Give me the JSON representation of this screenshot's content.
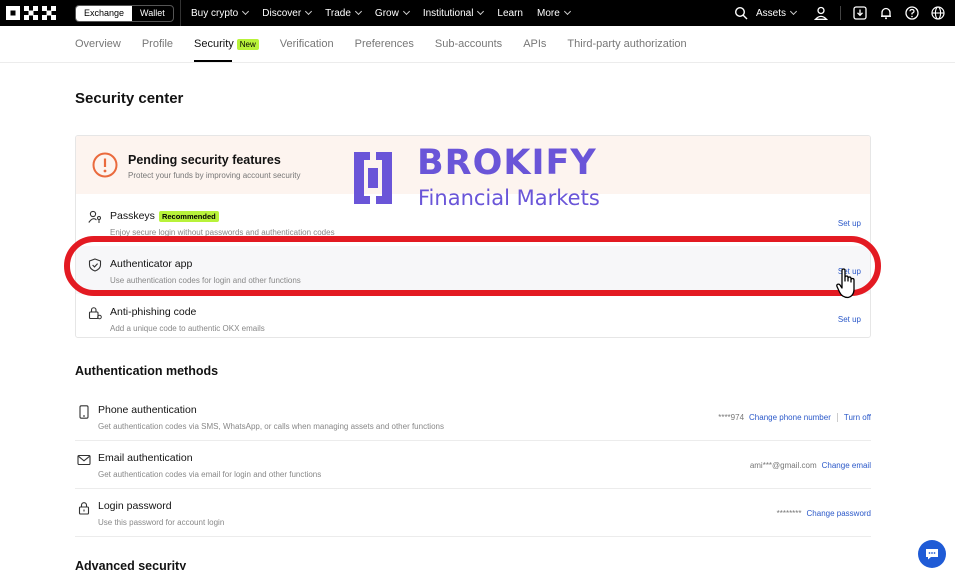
{
  "nav": {
    "toggle": [
      "Exchange",
      "Wallet"
    ],
    "items": [
      {
        "label": "Buy crypto",
        "chevron": true
      },
      {
        "label": "Discover",
        "chevron": true
      },
      {
        "label": "Trade",
        "chevron": true
      },
      {
        "label": "Grow",
        "chevron": true
      },
      {
        "label": "Institutional",
        "chevron": true
      },
      {
        "label": "Learn",
        "chevron": false
      },
      {
        "label": "More",
        "chevron": true
      }
    ],
    "assets": "Assets"
  },
  "tabs": [
    {
      "label": "Overview"
    },
    {
      "label": "Profile"
    },
    {
      "label": "Security",
      "badge": "New",
      "active": true
    },
    {
      "label": "Verification"
    },
    {
      "label": "Preferences"
    },
    {
      "label": "Sub-accounts"
    },
    {
      "label": "APIs"
    },
    {
      "label": "Third-party authorization"
    }
  ],
  "page_title": "Security center",
  "pending": {
    "title": "Pending security features",
    "subtitle": "Protect your funds by improving account security",
    "rows": [
      {
        "title": "Passkeys",
        "badge": "Recommended",
        "subtitle": "Enjoy secure login without passwords and authentication codes",
        "action": "Set up"
      },
      {
        "title": "Authenticator app",
        "subtitle": "Use authentication codes for login and other functions",
        "action": "Set up"
      },
      {
        "title": "Anti-phishing code",
        "subtitle": "Add a unique code to authentic OKX emails",
        "action": "Set up"
      }
    ]
  },
  "watermark": {
    "name": "BROKIFY",
    "tagline": "Financial Markets"
  },
  "auth": {
    "title": "Authentication methods",
    "rows": [
      {
        "title": "Phone authentication",
        "subtitle": "Get authentication codes via SMS, WhatsApp, or calls when managing assets and other functions",
        "mask": "****974",
        "links": [
          "Change phone number",
          "Turn off"
        ]
      },
      {
        "title": "Email authentication",
        "subtitle": "Get authentication codes via email for login and other functions",
        "mask": "ami***@gmail.com",
        "links": [
          "Change email"
        ]
      },
      {
        "title": "Login password",
        "subtitle": "Use this password for account login",
        "mask": "********",
        "links": [
          "Change password"
        ]
      }
    ]
  },
  "advanced_title": "Advanced security",
  "colors": {
    "accent": "#2a58c9",
    "badge": "#b8f23a",
    "highlight": "#e31a22",
    "watermark": "#6a55d8"
  }
}
